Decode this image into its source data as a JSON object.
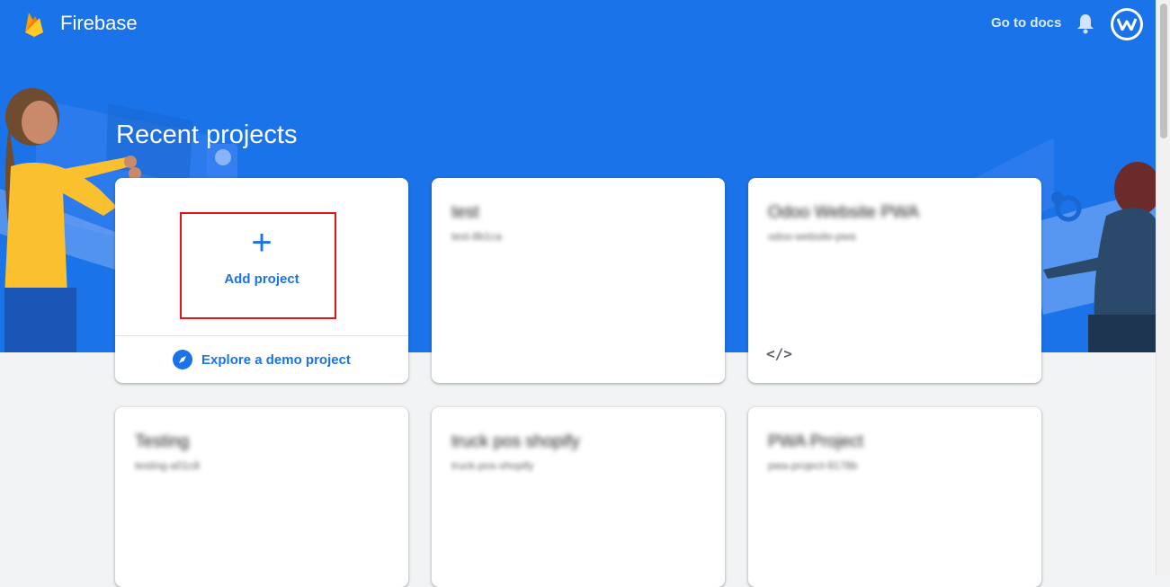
{
  "app": {
    "brand": "Firebase",
    "docs_link": "Go to docs",
    "icons": {
      "logo": "firebase-flame-icon",
      "bell": "notifications-bell-icon",
      "avatar": "user-avatar"
    },
    "colors": {
      "primary": "#1a73e8",
      "background": "#f1f3f4",
      "highlight": "#e8141c"
    }
  },
  "main": {
    "heading": "Recent projects",
    "add_project": {
      "label": "Add project",
      "icon": "+"
    },
    "demo_project": {
      "label": "Explore a demo project",
      "icon": "compass-icon"
    },
    "projects": [
      {
        "title": "test",
        "id": "test-8b1ca"
      },
      {
        "title": "Odoo Website PWA",
        "id": "odoo-website-pwa",
        "icon": "</>"
      },
      {
        "title": "Testing",
        "id": "testing-a01c8"
      },
      {
        "title": "truck pos shopify",
        "id": "truck-pos-shopify"
      },
      {
        "title": "PWA Project",
        "id": "pwa-project-9178b"
      }
    ]
  }
}
